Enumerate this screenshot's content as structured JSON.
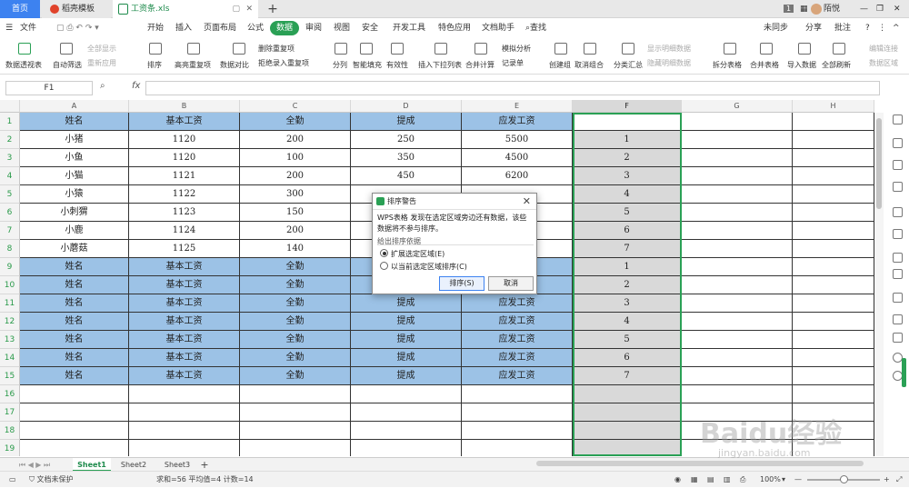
{
  "tabbar": {
    "home": "首页",
    "doc_tab": "稻壳模板",
    "file_tab": "工资条.xls",
    "new_tab": "+",
    "badge": "1",
    "user": "陌悦"
  },
  "menu": {
    "file": "文件",
    "items": [
      "开始",
      "插入",
      "页面布局",
      "公式",
      "数据",
      "审阅",
      "视图",
      "安全",
      "开发工具",
      "特色应用",
      "文档助手"
    ],
    "search": "查找",
    "right": [
      "未同步",
      "分享",
      "批注"
    ]
  },
  "ribbon": {
    "big": [
      "数据透视表",
      "自动筛选",
      "排序",
      "高亮重复项",
      "数据对比",
      "分列",
      "智能填充",
      "有效性",
      "插入下拉列表",
      "合并计算",
      "创建组",
      "取消组合",
      "分类汇总",
      "拆分表格",
      "合并表格",
      "导入数据",
      "全部刷新"
    ],
    "small": [
      "全部显示",
      "重新应用",
      "删除重复项",
      "拒绝录入重复项",
      "模拟分析",
      "记录单",
      "显示明细数据",
      "隐藏明细数据",
      "编辑连接",
      "数据区域"
    ]
  },
  "formula": {
    "cell_ref": "F1",
    "fx": "fx",
    "value": ""
  },
  "columns": [
    "A",
    "B",
    "C",
    "D",
    "E",
    "F",
    "G",
    "H"
  ],
  "row_numbers": [
    "1",
    "2",
    "3",
    "4",
    "5",
    "6",
    "7",
    "8",
    "9",
    "10",
    "11",
    "12",
    "13",
    "14",
    "15",
    "16",
    "17",
    "18",
    "19"
  ],
  "rows": [
    {
      "a": "姓名",
      "b": "基本工资",
      "c": "全勤",
      "d": "提成",
      "e": "应发工资",
      "f": ""
    },
    {
      "a": "小猪",
      "b": "1120",
      "c": "200",
      "d": "250",
      "e": "5500",
      "f": "1"
    },
    {
      "a": "小鱼",
      "b": "1120",
      "c": "100",
      "d": "350",
      "e": "4500",
      "f": "2"
    },
    {
      "a": "小猫",
      "b": "1121",
      "c": "200",
      "d": "450",
      "e": "6200",
      "f": "3"
    },
    {
      "a": "小猿",
      "b": "1122",
      "c": "300",
      "d": "",
      "e": "",
      "f": "4"
    },
    {
      "a": "小刺猬",
      "b": "1123",
      "c": "150",
      "d": "",
      "e": "",
      "f": "5"
    },
    {
      "a": "小鹿",
      "b": "1124",
      "c": "200",
      "d": "",
      "e": "",
      "f": "6"
    },
    {
      "a": "小蘑菇",
      "b": "1125",
      "c": "140",
      "d": "",
      "e": "",
      "f": "7"
    },
    {
      "a": "姓名",
      "b": "基本工资",
      "c": "全勤",
      "d": "",
      "e": "",
      "f": "1"
    },
    {
      "a": "姓名",
      "b": "基本工资",
      "c": "全勤",
      "d": "",
      "e": "",
      "f": "2"
    },
    {
      "a": "姓名",
      "b": "基本工资",
      "c": "全勤",
      "d": "提成",
      "e": "应发工资",
      "f": "3"
    },
    {
      "a": "姓名",
      "b": "基本工资",
      "c": "全勤",
      "d": "提成",
      "e": "应发工资",
      "f": "4"
    },
    {
      "a": "姓名",
      "b": "基本工资",
      "c": "全勤",
      "d": "提成",
      "e": "应发工资",
      "f": "5"
    },
    {
      "a": "姓名",
      "b": "基本工资",
      "c": "全勤",
      "d": "提成",
      "e": "应发工资",
      "f": "6"
    },
    {
      "a": "姓名",
      "b": "基本工资",
      "c": "全勤",
      "d": "提成",
      "e": "应发工资",
      "f": "7"
    }
  ],
  "sheets": [
    "Sheet1",
    "Sheet2",
    "Sheet3"
  ],
  "status": {
    "protect": "文档未保护",
    "stats": "求和=56  平均值=4  计数=14",
    "zoom": "100%"
  },
  "dialog": {
    "title": "排序警告",
    "message": "WPS表格 发现在选定区域旁边还有数据，该些数据将不参与排序。",
    "group_label": "给出排序依据",
    "option1": "扩展选定区域(E)",
    "option2": "以当前选定区域排序(C)",
    "ok": "排序(S)",
    "cancel": "取消"
  },
  "watermark": {
    "line1": "Baidu经验",
    "line2": "jingyan.baidu.com"
  }
}
